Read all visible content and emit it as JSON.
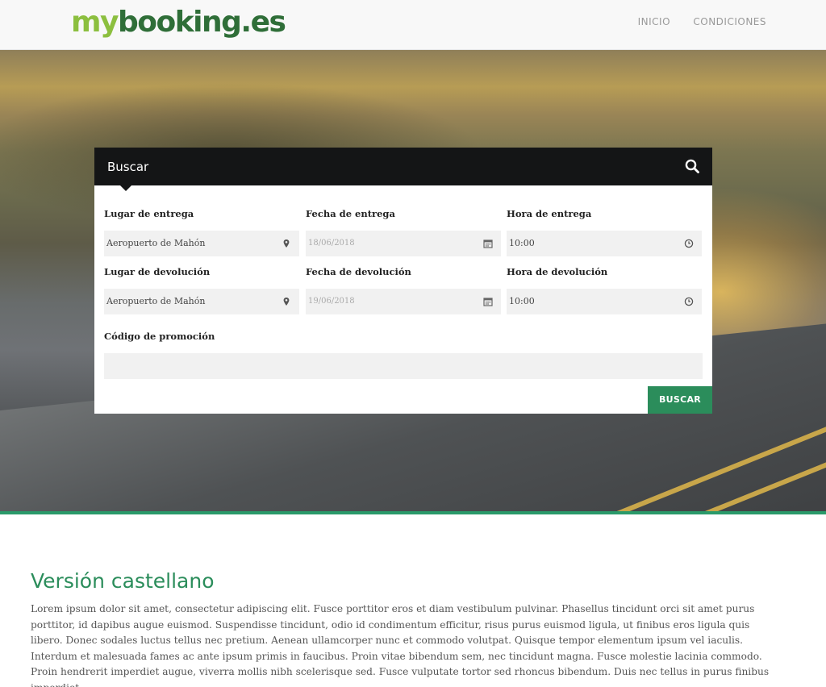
{
  "header": {
    "logo": {
      "part1": "my",
      "part2": "booking",
      "part3": ".es"
    },
    "nav": [
      {
        "label": "INICIO"
      },
      {
        "label": "CONDICIONES"
      }
    ]
  },
  "search": {
    "title": "Buscar",
    "fields": {
      "pickup_place": {
        "label": "Lugar de entrega",
        "value": "Aeropuerto de Mahón",
        "icon": "map-marker-icon"
      },
      "pickup_date": {
        "label": "Fecha de entrega",
        "value": "18/06/2018",
        "icon": "calendar-icon"
      },
      "pickup_time": {
        "label": "Hora de entrega",
        "value": "10:00",
        "icon": "clock-icon"
      },
      "return_place": {
        "label": "Lugar de devolución",
        "value": "Aeropuerto de Mahón",
        "icon": "map-marker-icon"
      },
      "return_date": {
        "label": "Fecha de devolución",
        "value": "19/06/2018",
        "icon": "calendar-icon"
      },
      "return_time": {
        "label": "Hora de devolución",
        "value": "10:00",
        "icon": "clock-icon"
      },
      "promo": {
        "label": "Código de promoción",
        "value": ""
      }
    },
    "submit_label": "BUSCAR"
  },
  "content": {
    "title": "Versión castellano",
    "body": "Lorem ipsum dolor sit amet, consectetur adipiscing elit. Fusce porttitor eros et diam vestibulum pulvinar. Phasellus tincidunt orci sit amet purus porttitor, id dapibus augue euismod. Suspendisse tincidunt, odio id condimentum efficitur, risus purus euismod ligula, ut finibus eros ligula quis libero. Donec sodales luctus tellus nec pretium. Aenean ullamcorper nunc et commodo volutpat. Quisque tempor elementum ipsum vel iaculis. Interdum et malesuada fames ac ante ipsum primis in faucibus. Proin vitae bibendum sem, nec tincidunt magna. Fusce molestie lacinia commodo. Proin hendrerit imperdiet augue, viverra mollis nibh scelerisque sed. Fusce vulputate tortor sed rhoncus bibendum. Duis nec tellus in purus finibus imperdiet."
  },
  "colors": {
    "brand_green": "#2b8d5b",
    "logo_light_green": "#8cbf3f",
    "logo_dark_green": "#2f6e38",
    "search_header_bg": "#141516"
  }
}
